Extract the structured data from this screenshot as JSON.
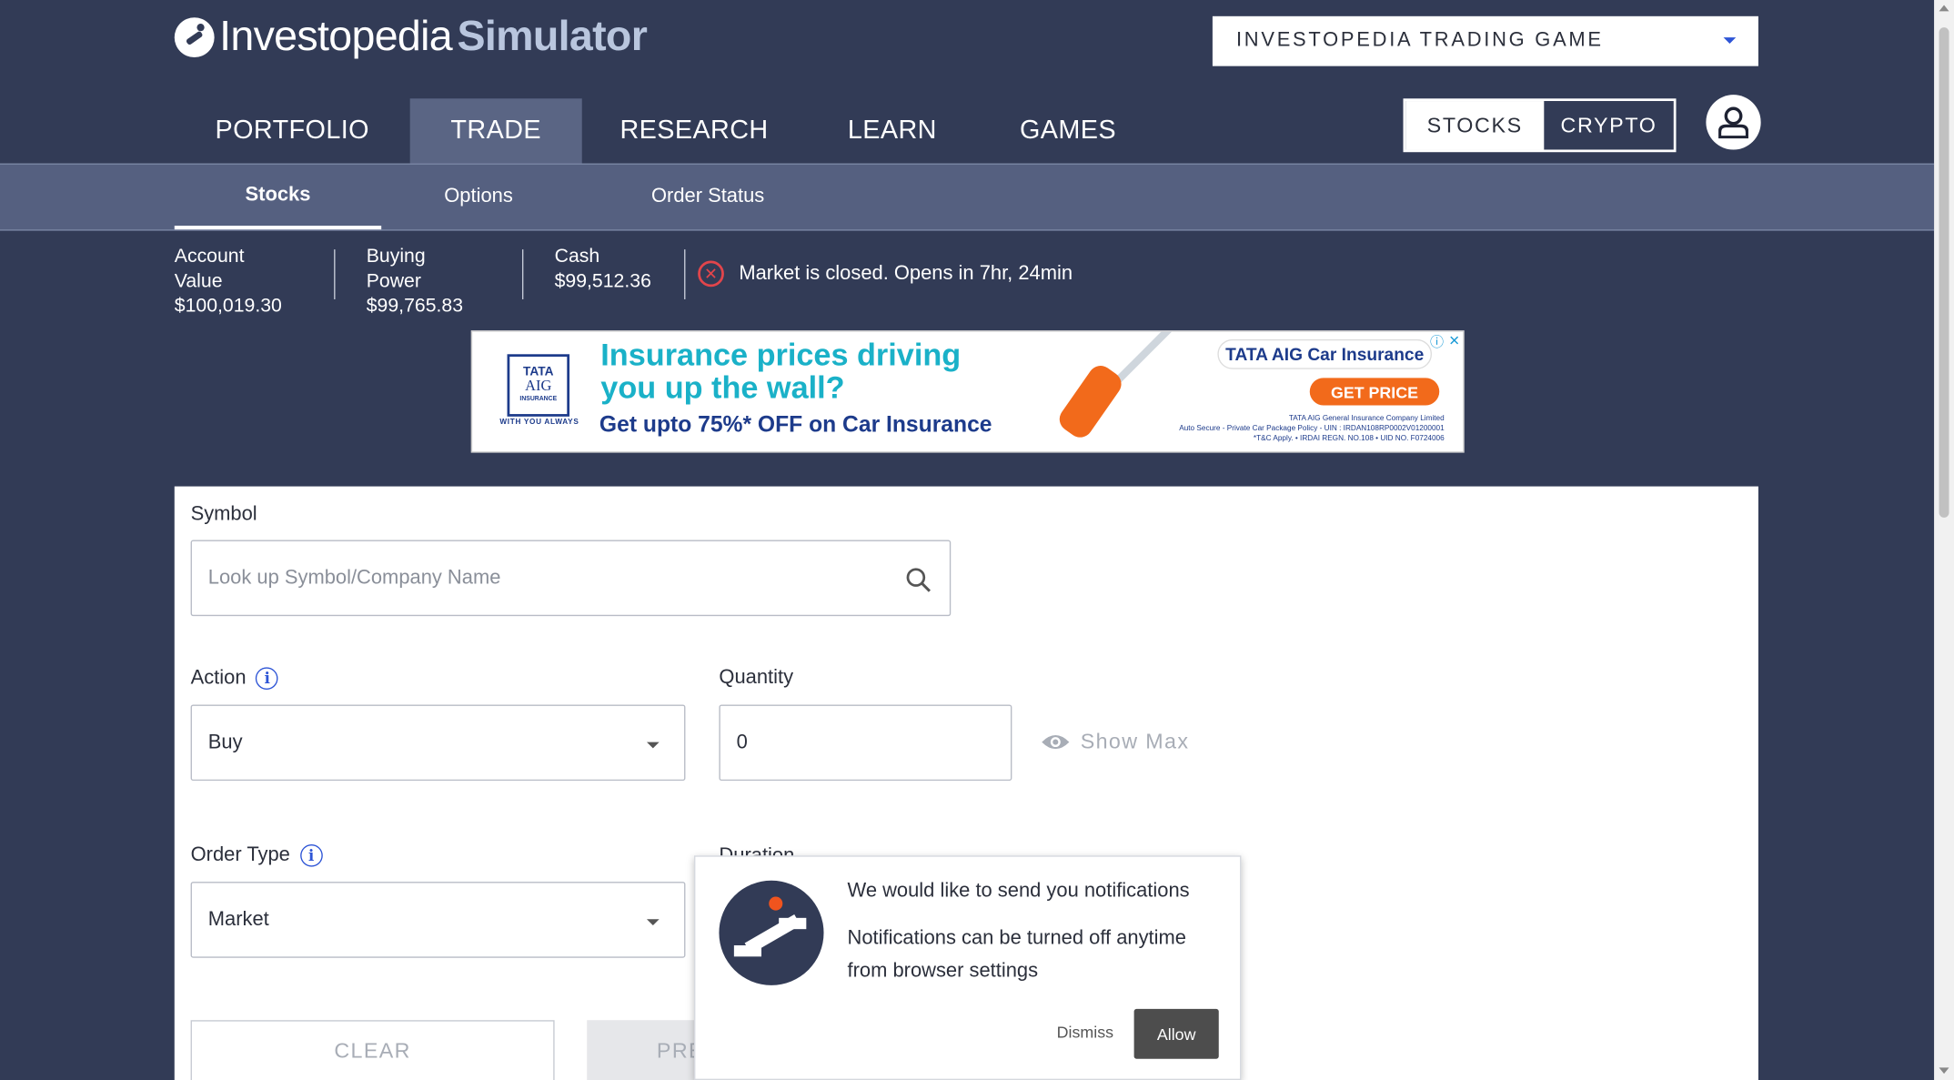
{
  "header": {
    "logo_part1": "Investopedia",
    "logo_part2": "Simulator",
    "game_select": "INVESTOPEDIA TRADING GAME"
  },
  "main_nav": [
    {
      "label": "PORTFOLIO",
      "active": false
    },
    {
      "label": "TRADE",
      "active": true
    },
    {
      "label": "RESEARCH",
      "active": false
    },
    {
      "label": "LEARN",
      "active": false
    },
    {
      "label": "GAMES",
      "active": false
    }
  ],
  "asset_toggle": {
    "stocks": "STOCKS",
    "crypto": "CRYPTO",
    "selected": "STOCKS"
  },
  "sub_nav": [
    {
      "label": "Stocks",
      "active": true
    },
    {
      "label": "Options",
      "active": false
    },
    {
      "label": "Order Status",
      "active": false
    }
  ],
  "stats": {
    "account_value_label": "Account Value",
    "account_value": "$100,019.30",
    "buying_power_label": "Buying Power",
    "buying_power": "$99,765.83",
    "cash_label": "Cash",
    "cash": "$99,512.36",
    "market_status": "Market is closed. Opens in 7hr, 24min"
  },
  "ad": {
    "brand_line1": "TATA",
    "brand_line2": "AIG",
    "brand_line3": "INSURANCE",
    "tagline": "WITH YOU ALWAYS",
    "headline_1": "Insurance prices driving",
    "headline_2": "you up the wall?",
    "subhead": "Get upto 75%* OFF on Car Insurance",
    "pill": "TATA AIG Car Insurance",
    "cta": "GET PRICE",
    "fine_print_1": "TATA AIG General Insurance Company Limited",
    "fine_print_2": "Auto Secure - Private Car Package Policy - UIN : IRDAN108RP0002V01200001",
    "fine_print_3": "*T&C Apply. • IRDAI REGN. NO.108 • UID NO. F0724006"
  },
  "form": {
    "symbol_label": "Symbol",
    "symbol_placeholder": "Look up Symbol/Company Name",
    "action_label": "Action",
    "action_value": "Buy",
    "quantity_label": "Quantity",
    "quantity_value": "0",
    "show_max": "Show Max",
    "order_type_label": "Order Type",
    "order_type_value": "Market",
    "duration_label": "Duration",
    "clear_button": "CLEAR",
    "preview_button": "PRE"
  },
  "notification": {
    "title": "We would like to send you notifications",
    "body": "Notifications can be turned off anytime from browser settings",
    "dismiss": "Dismiss",
    "allow": "Allow"
  },
  "colors": {
    "header_bg": "#323b56",
    "subnav_bg": "#556080",
    "active_tab": "#5a6584",
    "info_blue": "#2e55d6",
    "error_red": "#e2454b"
  }
}
